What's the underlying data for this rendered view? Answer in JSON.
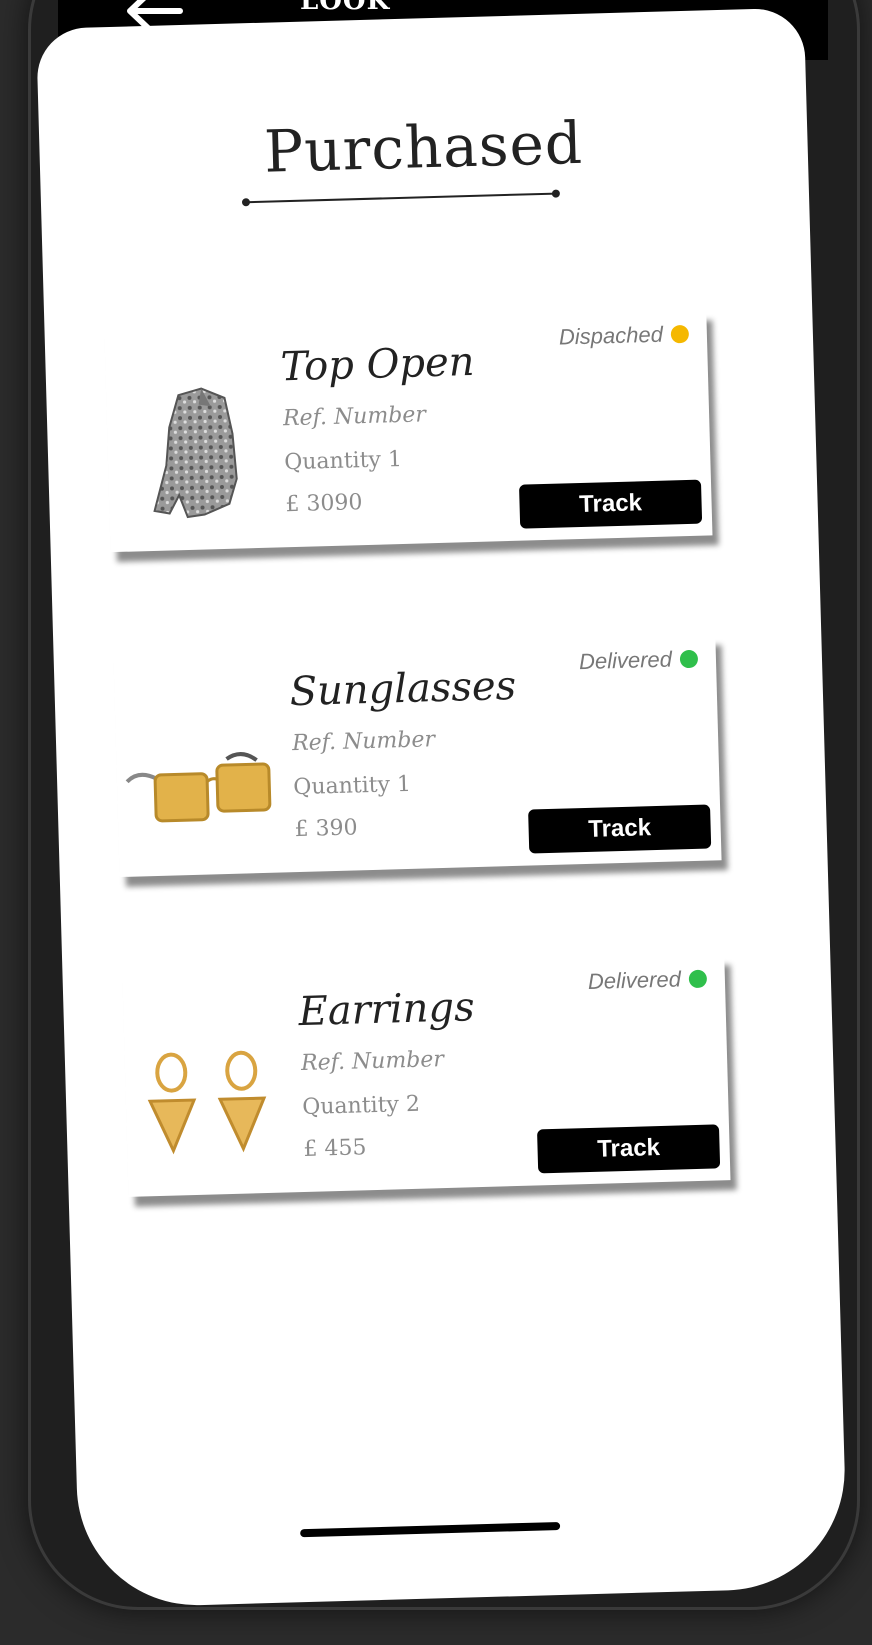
{
  "header": {
    "brand_partial": "LOOK"
  },
  "page": {
    "title": "Purchased"
  },
  "orders": [
    {
      "name": "Top Open",
      "ref_label": "Ref. Number",
      "quantity": "Quantity 1",
      "price": "£ 3090",
      "status": "Dispached",
      "status_color": "#f5b800",
      "action_label": "Track",
      "icon": "jacket-icon"
    },
    {
      "name": "Sunglasses",
      "ref_label": "Ref. Number",
      "quantity": "Quantity 1",
      "price": "£ 390",
      "status": "Delivered",
      "status_color": "#2fbf4b",
      "action_label": "Track",
      "icon": "sunglasses-icon"
    },
    {
      "name": "Earrings",
      "ref_label": "Ref. Number",
      "quantity": "Quantity 2",
      "price": "£ 455",
      "status": "Delivered",
      "status_color": "#2fbf4b",
      "action_label": "Track",
      "icon": "earrings-icon"
    }
  ]
}
